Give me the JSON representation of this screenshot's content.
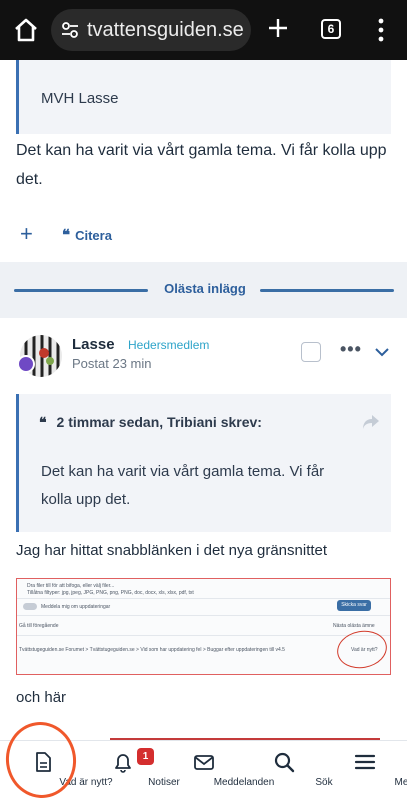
{
  "browser": {
    "url": "tvattensguiden.se",
    "tab_count": "6",
    "icons": [
      "home-icon",
      "site-settings-icon",
      "new-tab-icon",
      "tab-switcher-icon",
      "more-vert-icon"
    ]
  },
  "previous_post": {
    "quote_text": "MVH Lasse",
    "body_line1": "Det kan ha varit via vårt gamla tema. Vi får kolla upp",
    "body_line2": "det.",
    "quote_button": "Citera"
  },
  "unread_divider": "Olästa inlägg",
  "post": {
    "author": "Lasse",
    "user_title": "Hedersmedlem",
    "posted": "Postat 23 min",
    "quote_header": "2 timmar sedan, Tribiani skrev:",
    "quote_line1": "Det kan ha varit via vårt gamla tema. Vi får",
    "quote_line2": "kolla upp det.",
    "text1": "Jag har hittat snabblänken i det nya gränsnittet",
    "text2": "och här",
    "attachment": {
      "line1": "Dra filer till för att bifoga, eller välj filer...",
      "line2": "Tillåtna filtyper: jpg, jpeg, JPG, PNG, png, PNG, doc, docx, xls, xlsx, pdf, txt",
      "toggle_label": "Meddela mig om uppdateringar",
      "button": "Skicka svar",
      "back_link": "Gå till föregående",
      "next_link": "Nästa olästa ämne",
      "breadcrumb": "Tvättstugeguiden.se Forumet  >  Tvättstugeguiden.se  >  Vid som har uppdatering fel  >  Buggar efter uppdateringen till v4.5",
      "new_link": "Vad är nytt?"
    }
  },
  "bottom_nav": {
    "items": [
      {
        "label": "Vad är nytt?",
        "icon": "document-icon"
      },
      {
        "label": "Notiser",
        "icon": "bell-icon",
        "badge": "1"
      },
      {
        "label": "Meddelanden",
        "icon": "envelope-icon"
      },
      {
        "label": "Sök",
        "icon": "search-icon"
      },
      {
        "label": "Menu",
        "icon": "hamburger-icon"
      }
    ]
  },
  "colors": {
    "accent": "#2d5f9c",
    "quote_border": "#3a70b3",
    "user_title": "#2ea4c9",
    "badge_red": "#d42e2e",
    "annotation": "#f0582b"
  }
}
